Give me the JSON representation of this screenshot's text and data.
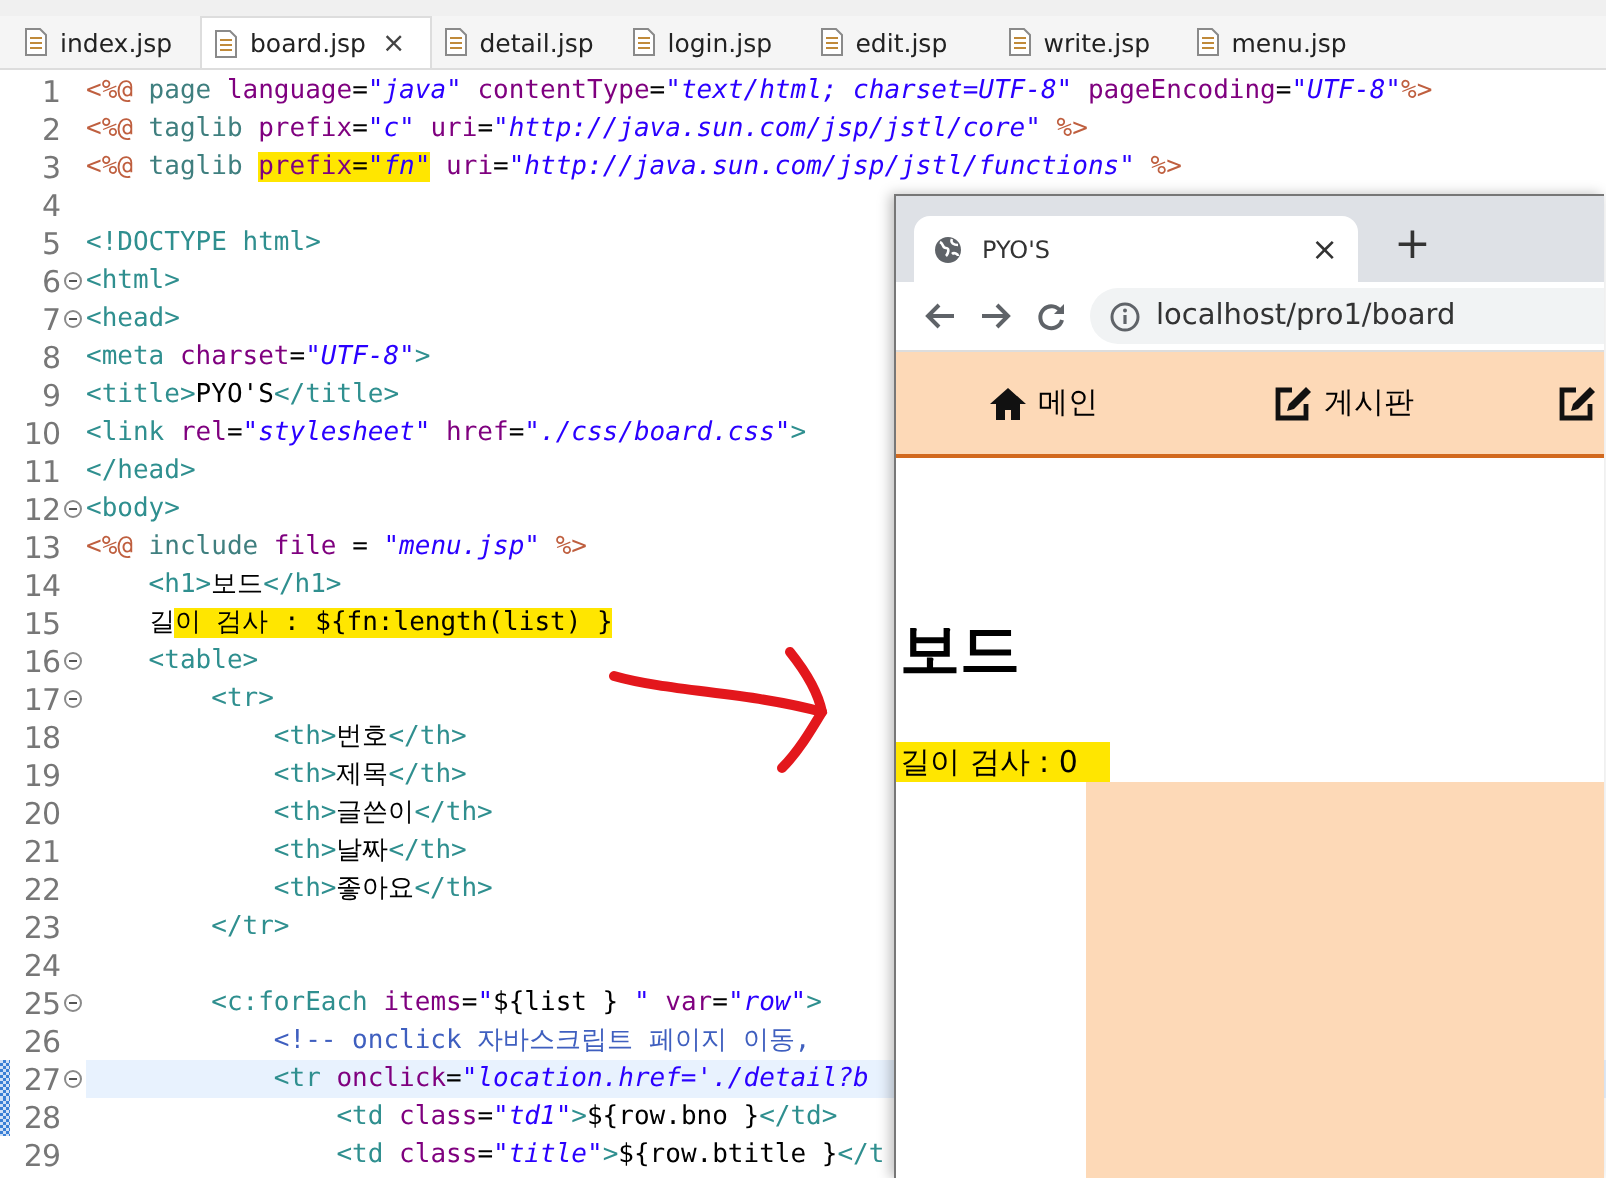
{
  "editor": {
    "tabs": [
      {
        "label": "index.jsp",
        "selected": false
      },
      {
        "label": "board.jsp",
        "selected": true,
        "close": "×"
      },
      {
        "label": "detail.jsp",
        "selected": false
      },
      {
        "label": "login.jsp",
        "selected": false
      },
      {
        "label": "edit.jsp",
        "selected": false
      },
      {
        "label": "write.jsp",
        "selected": false
      },
      {
        "label": "menu.jsp",
        "selected": false
      }
    ],
    "lines": [
      {
        "number": "1",
        "fold": false,
        "current": false,
        "changed": false,
        "segments": [
          {
            "kind": "directive",
            "text": "<%@",
            "highlighted": false
          },
          {
            "kind": "keyword",
            "text": " page",
            "highlighted": false
          },
          {
            "kind": "attribute",
            "text": " language",
            "highlighted": false
          },
          {
            "kind": "text",
            "text": "=",
            "highlighted": false
          },
          {
            "kind": "string",
            "text": "\"java\"",
            "highlighted": false
          },
          {
            "kind": "attribute",
            "text": " contentType",
            "highlighted": false
          },
          {
            "kind": "text",
            "text": "=",
            "highlighted": false
          },
          {
            "kind": "string",
            "text": "\"text/html; charset=UTF-8\"",
            "highlighted": false
          },
          {
            "kind": "attribute",
            "text": " pageEncoding",
            "highlighted": false
          },
          {
            "kind": "text",
            "text": "=",
            "highlighted": false
          },
          {
            "kind": "string",
            "text": "\"UTF-8\"",
            "highlighted": false
          },
          {
            "kind": "directive",
            "text": "%>",
            "highlighted": false
          }
        ]
      },
      {
        "number": "2",
        "fold": false,
        "current": false,
        "changed": false,
        "segments": [
          {
            "kind": "directive",
            "text": "<%@",
            "highlighted": false
          },
          {
            "kind": "keyword",
            "text": " taglib",
            "highlighted": false
          },
          {
            "kind": "attribute",
            "text": " prefix",
            "highlighted": false
          },
          {
            "kind": "text",
            "text": "=",
            "highlighted": false
          },
          {
            "kind": "string",
            "text": "\"c\"",
            "highlighted": false
          },
          {
            "kind": "attribute",
            "text": " uri",
            "highlighted": false
          },
          {
            "kind": "text",
            "text": "=",
            "highlighted": false
          },
          {
            "kind": "string",
            "text": "\"http://java.sun.com/jsp/jstl/core\"",
            "highlighted": false
          },
          {
            "kind": "directive",
            "text": " %>",
            "highlighted": false
          }
        ]
      },
      {
        "number": "3",
        "fold": false,
        "current": false,
        "changed": false,
        "segments": [
          {
            "kind": "directive",
            "text": "<%@",
            "highlighted": false
          },
          {
            "kind": "keyword",
            "text": " taglib ",
            "highlighted": false
          },
          {
            "kind": "attribute",
            "text": "prefix",
            "highlighted": true
          },
          {
            "kind": "text",
            "text": "=",
            "highlighted": true
          },
          {
            "kind": "string",
            "text": "\"fn\"",
            "highlighted": true
          },
          {
            "kind": "attribute",
            "text": " uri",
            "highlighted": false
          },
          {
            "kind": "text",
            "text": "=",
            "highlighted": false
          },
          {
            "kind": "string",
            "text": "\"http://java.sun.com/jsp/jstl/functions\"",
            "highlighted": false
          },
          {
            "kind": "directive",
            "text": " %>",
            "highlighted": false
          }
        ]
      },
      {
        "number": "4",
        "fold": false,
        "current": false,
        "changed": false
      },
      {
        "number": "5",
        "fold": false,
        "current": false,
        "changed": false,
        "segments": [
          {
            "kind": "tag",
            "text": "<!DOCTYPE html>",
            "highlighted": false
          }
        ]
      },
      {
        "number": "6",
        "fold": true,
        "current": false,
        "changed": false,
        "segments": [
          {
            "kind": "tag",
            "text": "<html>",
            "highlighted": false
          }
        ]
      },
      {
        "number": "7",
        "fold": true,
        "current": false,
        "changed": false,
        "segments": [
          {
            "kind": "tag",
            "text": "<head>",
            "highlighted": false
          }
        ]
      },
      {
        "number": "8",
        "fold": false,
        "current": false,
        "changed": false,
        "segments": [
          {
            "kind": "tag",
            "text": "<meta",
            "highlighted": false
          },
          {
            "kind": "attribute",
            "text": " charset",
            "highlighted": false
          },
          {
            "kind": "text",
            "text": "=",
            "highlighted": false
          },
          {
            "kind": "string",
            "text": "\"UTF-8\"",
            "highlighted": false
          },
          {
            "kind": "tag",
            "text": ">",
            "highlighted": false
          }
        ]
      },
      {
        "number": "9",
        "fold": false,
        "current": false,
        "changed": false,
        "segments": [
          {
            "kind": "tag",
            "text": "<title>",
            "highlighted": false
          },
          {
            "kind": "text",
            "text": "PYO'S",
            "highlighted": false
          },
          {
            "kind": "tag",
            "text": "</title>",
            "highlighted": false
          }
        ]
      },
      {
        "number": "10",
        "fold": false,
        "current": false,
        "changed": false,
        "segments": [
          {
            "kind": "tag",
            "text": "<link",
            "highlighted": false
          },
          {
            "kind": "attribute",
            "text": " rel",
            "highlighted": false
          },
          {
            "kind": "text",
            "text": "=",
            "highlighted": false
          },
          {
            "kind": "string",
            "text": "\"stylesheet\"",
            "highlighted": false
          },
          {
            "kind": "attribute",
            "text": " href",
            "highlighted": false
          },
          {
            "kind": "text",
            "text": "=",
            "highlighted": false
          },
          {
            "kind": "string",
            "text": "\"./css/board.css\"",
            "highlighted": false
          },
          {
            "kind": "tag",
            "text": ">",
            "highlighted": false
          }
        ]
      },
      {
        "number": "11",
        "fold": false,
        "current": false,
        "changed": false,
        "segments": [
          {
            "kind": "tag",
            "text": "</head>",
            "highlighted": false
          }
        ]
      },
      {
        "number": "12",
        "fold": true,
        "current": false,
        "changed": false,
        "segments": [
          {
            "kind": "tag",
            "text": "<body>",
            "highlighted": false
          }
        ]
      },
      {
        "number": "13",
        "fold": false,
        "current": false,
        "changed": false,
        "segments": [
          {
            "kind": "directive",
            "text": "<%@",
            "highlighted": false
          },
          {
            "kind": "keyword",
            "text": " include",
            "highlighted": false
          },
          {
            "kind": "attribute",
            "text": " file",
            "highlighted": false
          },
          {
            "kind": "text",
            "text": " = ",
            "highlighted": false
          },
          {
            "kind": "string",
            "text": "\"menu.jsp\"",
            "highlighted": false
          },
          {
            "kind": "directive",
            "text": " %>",
            "highlighted": false
          }
        ]
      },
      {
        "number": "14",
        "fold": false,
        "current": false,
        "changed": false,
        "segments": [
          {
            "kind": "tag",
            "text": "    <h1>",
            "highlighted": false
          },
          {
            "kind": "text",
            "text": "보드",
            "highlighted": false
          },
          {
            "kind": "tag",
            "text": "</h1>",
            "highlighted": false
          }
        ]
      },
      {
        "number": "15",
        "fold": false,
        "current": false,
        "changed": false,
        "segments": [
          {
            "kind": "text",
            "text": "    길",
            "highlighted": false
          },
          {
            "kind": "text",
            "text": "이 검사 : ${fn:length(list) }",
            "highlighted": true
          }
        ]
      },
      {
        "number": "16",
        "fold": true,
        "current": false,
        "changed": false,
        "segments": [
          {
            "kind": "tag",
            "text": "    <table>",
            "highlighted": false
          }
        ]
      },
      {
        "number": "17",
        "fold": true,
        "current": false,
        "changed": false,
        "segments": [
          {
            "kind": "tag",
            "text": "        <tr>",
            "highlighted": false
          }
        ]
      },
      {
        "number": "18",
        "fold": false,
        "current": false,
        "changed": false,
        "segments": [
          {
            "kind": "tag",
            "text": "            <th>",
            "highlighted": false
          },
          {
            "kind": "text",
            "text": "번호",
            "highlighted": false
          },
          {
            "kind": "tag",
            "text": "</th>",
            "highlighted": false
          }
        ]
      },
      {
        "number": "19",
        "fold": false,
        "current": false,
        "changed": false,
        "segments": [
          {
            "kind": "tag",
            "text": "            <th>",
            "highlighted": false
          },
          {
            "kind": "text",
            "text": "제목",
            "highlighted": false
          },
          {
            "kind": "tag",
            "text": "</th>",
            "highlighted": false
          }
        ]
      },
      {
        "number": "20",
        "fold": false,
        "current": false,
        "changed": false,
        "segments": [
          {
            "kind": "tag",
            "text": "            <th>",
            "highlighted": false
          },
          {
            "kind": "text",
            "text": "글쓴이",
            "highlighted": false
          },
          {
            "kind": "tag",
            "text": "</th>",
            "highlighted": false
          }
        ]
      },
      {
        "number": "21",
        "fold": false,
        "current": false,
        "changed": false,
        "segments": [
          {
            "kind": "tag",
            "text": "            <th>",
            "highlighted": false
          },
          {
            "kind": "text",
            "text": "날짜",
            "highlighted": false
          },
          {
            "kind": "tag",
            "text": "</th>",
            "highlighted": false
          }
        ]
      },
      {
        "number": "22",
        "fold": false,
        "current": false,
        "changed": false,
        "segments": [
          {
            "kind": "tag",
            "text": "            <th>",
            "highlighted": false
          },
          {
            "kind": "text",
            "text": "좋아요",
            "highlighted": false
          },
          {
            "kind": "tag",
            "text": "</th>",
            "highlighted": false
          }
        ]
      },
      {
        "number": "23",
        "fold": false,
        "current": false,
        "changed": false,
        "segments": [
          {
            "kind": "tag",
            "text": "        </tr>",
            "highlighted": false
          }
        ]
      },
      {
        "number": "24",
        "fold": false,
        "current": false,
        "changed": false
      },
      {
        "number": "25",
        "fold": true,
        "current": false,
        "changed": false,
        "segments": [
          {
            "kind": "tag",
            "text": "        <c:forEach",
            "highlighted": false
          },
          {
            "kind": "attribute",
            "text": " items",
            "highlighted": false
          },
          {
            "kind": "text",
            "text": "=",
            "highlighted": false
          },
          {
            "kind": "string",
            "text": "\"",
            "highlighted": false
          },
          {
            "kind": "text",
            "text": "${list }",
            "highlighted": false
          },
          {
            "kind": "string",
            "text": " \"",
            "highlighted": false
          },
          {
            "kind": "attribute",
            "text": " var",
            "highlighted": false
          },
          {
            "kind": "text",
            "text": "=",
            "highlighted": false
          },
          {
            "kind": "string",
            "text": "\"row\"",
            "highlighted": false
          },
          {
            "kind": "tag",
            "text": ">",
            "highlighted": false
          }
        ]
      },
      {
        "number": "26",
        "fold": false,
        "current": false,
        "changed": false,
        "segments": [
          {
            "kind": "comment",
            "text": "            <!-- onclick 자바스크립트 페이지 이동,",
            "highlighted": false
          }
        ]
      },
      {
        "number": "27",
        "fold": true,
        "current": true,
        "changed": true,
        "segments": [
          {
            "kind": "tag",
            "text": "            <tr",
            "highlighted": false
          },
          {
            "kind": "attribute",
            "text": " onclick",
            "highlighted": false
          },
          {
            "kind": "text",
            "text": "=",
            "highlighted": false
          },
          {
            "kind": "string",
            "text": "\"location.href='./detail?b",
            "highlighted": false
          }
        ]
      },
      {
        "number": "28",
        "fold": false,
        "current": false,
        "changed": true,
        "segments": [
          {
            "kind": "tag",
            "text": "                <td",
            "highlighted": false
          },
          {
            "kind": "attribute",
            "text": " class",
            "highlighted": false
          },
          {
            "kind": "text",
            "text": "=",
            "highlighted": false
          },
          {
            "kind": "string",
            "text": "\"td1\"",
            "highlighted": false
          },
          {
            "kind": "tag",
            "text": ">",
            "highlighted": false
          },
          {
            "kind": "text",
            "text": "${row.bno }",
            "highlighted": false
          },
          {
            "kind": "tag",
            "text": "</td>",
            "highlighted": false
          }
        ]
      },
      {
        "number": "29",
        "fold": false,
        "current": false,
        "changed": false,
        "segments": [
          {
            "kind": "tag",
            "text": "                <td",
            "highlighted": false
          },
          {
            "kind": "attribute",
            "text": " class",
            "highlighted": false
          },
          {
            "kind": "text",
            "text": "=",
            "highlighted": false
          },
          {
            "kind": "string",
            "text": "\"title\"",
            "highlighted": false
          },
          {
            "kind": "tag",
            "text": ">",
            "highlighted": false
          },
          {
            "kind": "text",
            "text": "${row.btitle }",
            "highlighted": false
          },
          {
            "kind": "tag",
            "text": "</t",
            "highlighted": false
          }
        ]
      }
    ]
  },
  "browser": {
    "tab": {
      "title": "PYO'S",
      "close": "×",
      "new_tab": "+"
    },
    "address": "localhost/pro1/board",
    "nav": [
      {
        "kind": "home",
        "label": "메인"
      },
      {
        "kind": "edit",
        "label": "게시판"
      },
      {
        "kind": "edit"
      }
    ],
    "heading": "보드",
    "length_check": "길이 검사 : 0"
  }
}
